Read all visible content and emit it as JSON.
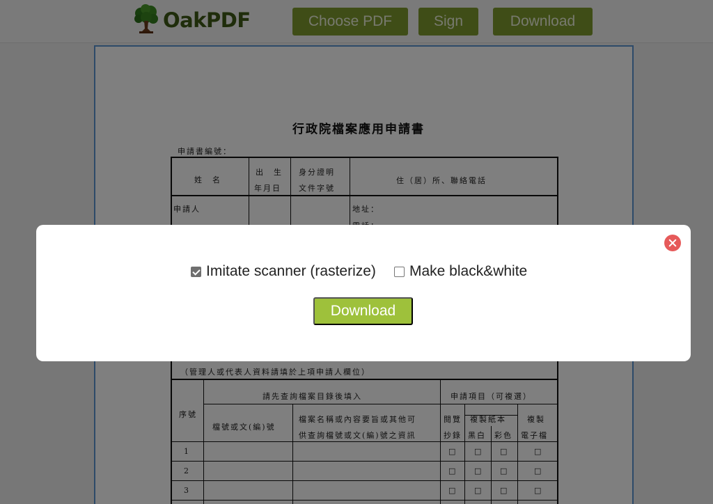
{
  "header": {
    "brand": "OakPDF",
    "nav": {
      "choose_pdf": "Choose PDF",
      "sign": "Sign",
      "download": "Download"
    }
  },
  "document": {
    "title": "行政院檔案應用申請書",
    "form_number_label": "申請書編號：",
    "table1_headers": {
      "name": "姓　名",
      "birth_line1": "出　生",
      "birth_line2": "年月日",
      "id_line1": "身分證明",
      "id_line2": "文件字號",
      "address": "住（居）所、聯絡電話"
    },
    "applicant_label": "申請人",
    "address_label": "地址：",
    "phone_label": "電話：",
    "note": "（管理人或代表人資料請填於上項申請人欄位）",
    "table2_headers": {
      "serial": "序號",
      "fill_after_query": "請先查詢檔案目錄後填入",
      "apply_items": "申請項目（可複選）",
      "file_number": "檔號或文(編)號",
      "content_line1": "檔案名稱或內容要旨或其他可",
      "content_line2": "供查詢檔號或文(編)號之資訊",
      "view_line1": "閱覽",
      "view_line2": "抄錄",
      "paper_copy": "複製紙本",
      "black_white": "黑白",
      "color": "彩色",
      "electronic_line1": "複製",
      "electronic_line2": "電子檔"
    },
    "rows": [
      "1",
      "2",
      "3"
    ],
    "checkbox_glyph": "□"
  },
  "modal": {
    "option_scanner": "Imitate scanner (rasterize)",
    "option_scanner_checked": true,
    "option_bw": "Make black&white",
    "option_bw_checked": false,
    "download_label": "Download",
    "close_icon": "close-icon",
    "accent_color": "#9ec13b",
    "close_color": "#e65a5a"
  }
}
